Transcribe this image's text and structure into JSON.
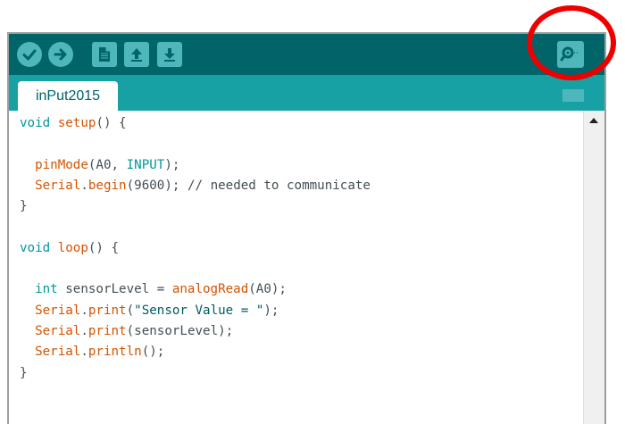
{
  "toolbar": {
    "buttons": [
      {
        "name": "verify",
        "icon": "checkmark-icon"
      },
      {
        "name": "upload",
        "icon": "arrow-right-icon"
      },
      {
        "name": "new",
        "icon": "document-icon"
      },
      {
        "name": "open",
        "icon": "arrow-up-icon"
      },
      {
        "name": "save",
        "icon": "arrow-down-icon"
      },
      {
        "name": "serial-monitor",
        "icon": "magnifier-icon"
      }
    ]
  },
  "tab": {
    "label": "inPut2015"
  },
  "code": {
    "lines": [
      {
        "parts": [
          {
            "t": "void",
            "c": "type"
          },
          {
            "t": " "
          },
          {
            "t": "setup",
            "c": "fn"
          },
          {
            "t": "() {"
          }
        ]
      },
      {
        "parts": []
      },
      {
        "parts": [
          {
            "t": "  "
          },
          {
            "t": "pinMode",
            "c": "fn"
          },
          {
            "t": "(A0, "
          },
          {
            "t": "INPUT",
            "c": "const"
          },
          {
            "t": ");"
          }
        ]
      },
      {
        "parts": [
          {
            "t": "  "
          },
          {
            "t": "Serial",
            "c": "fn"
          },
          {
            "t": "."
          },
          {
            "t": "begin",
            "c": "fn"
          },
          {
            "t": "(9600); // needed to communicate"
          }
        ]
      },
      {
        "parts": [
          {
            "t": "}"
          }
        ]
      },
      {
        "parts": []
      },
      {
        "parts": [
          {
            "t": "void",
            "c": "type"
          },
          {
            "t": " "
          },
          {
            "t": "loop",
            "c": "fn"
          },
          {
            "t": "() {"
          }
        ]
      },
      {
        "parts": []
      },
      {
        "parts": [
          {
            "t": "  "
          },
          {
            "t": "int",
            "c": "type"
          },
          {
            "t": " sensorLevel = "
          },
          {
            "t": "analogRead",
            "c": "fn"
          },
          {
            "t": "(A0);"
          }
        ]
      },
      {
        "parts": [
          {
            "t": "  "
          },
          {
            "t": "Serial",
            "c": "fn"
          },
          {
            "t": "."
          },
          {
            "t": "print",
            "c": "fn"
          },
          {
            "t": "("
          },
          {
            "t": "\"Sensor Value = \"",
            "c": "str"
          },
          {
            "t": ");"
          }
        ]
      },
      {
        "parts": [
          {
            "t": "  "
          },
          {
            "t": "Serial",
            "c": "fn"
          },
          {
            "t": "."
          },
          {
            "t": "print",
            "c": "fn"
          },
          {
            "t": "(sensorLevel);"
          }
        ]
      },
      {
        "parts": [
          {
            "t": "  "
          },
          {
            "t": "Serial",
            "c": "fn"
          },
          {
            "t": "."
          },
          {
            "t": "println",
            "c": "fn"
          },
          {
            "t": "();"
          }
        ]
      },
      {
        "parts": [
          {
            "t": "}"
          }
        ]
      }
    ]
  },
  "colors": {
    "toolbar_bg": "#006468",
    "tabbar_bg": "#17a1a5",
    "button_bg": "#4db7bb",
    "highlight": "#ee0000"
  }
}
